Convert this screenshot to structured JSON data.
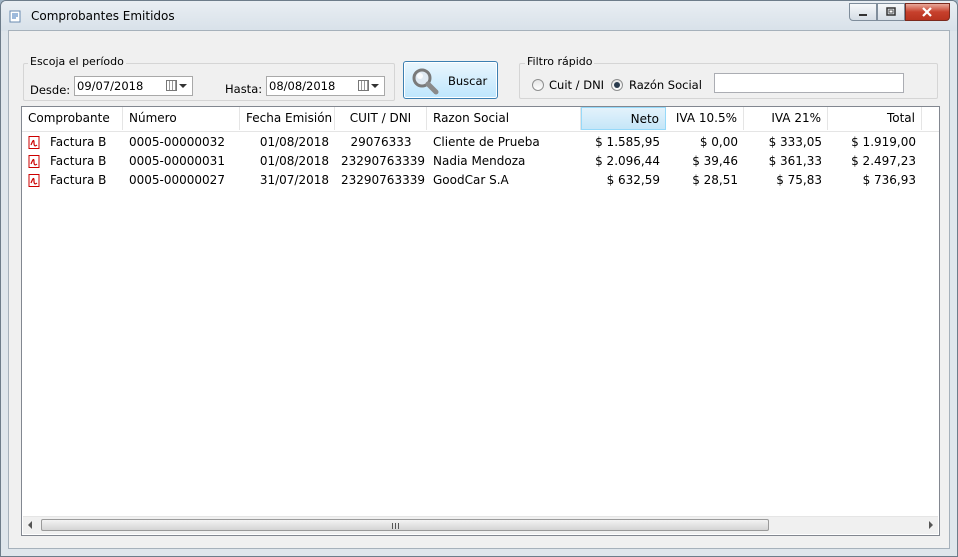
{
  "window": {
    "title": "Comprobantes Emitidos",
    "accent": "#3c7fb1"
  },
  "periodo": {
    "group_label": "Escoja el período",
    "desde_label": "Desde:",
    "desde_value": "09/07/2018",
    "hasta_label": "Hasta:",
    "hasta_value": "08/08/2018"
  },
  "buscar": {
    "label": "Buscar",
    "icon": "magnifier-icon"
  },
  "filtro": {
    "group_label": "Filtro rápido",
    "opt_cuit": "Cuit / DNI",
    "opt_razon": "Razón Social",
    "selected": "Razón Social",
    "search_value": ""
  },
  "table": {
    "columns": [
      "Comprobante",
      "Número",
      "Fecha Emisión",
      "CUIT / DNI",
      "Razon Social",
      "Neto",
      "IVA 10.5%",
      "IVA 21%",
      "Total"
    ],
    "sorted_column": "Neto",
    "rows": [
      {
        "tipo": "Factura B",
        "numero": "0005-00000032",
        "fecha": "01/08/2018",
        "cuit": "29076333",
        "razon": "Cliente de Prueba",
        "neto": "$ 1.585,95",
        "iva105": "$ 0,00",
        "iva21": "$ 333,05",
        "total": "$ 1.919,00"
      },
      {
        "tipo": "Factura B",
        "numero": "0005-00000031",
        "fecha": "01/08/2018",
        "cuit": "23290763339",
        "razon": "Nadia Mendoza",
        "neto": "$ 2.096,44",
        "iva105": "$ 39,46",
        "iva21": "$ 361,33",
        "total": "$ 2.497,23"
      },
      {
        "tipo": "Factura B",
        "numero": "0005-00000027",
        "fecha": "31/07/2018",
        "cuit": "23290763339",
        "razon": "GoodCar S.A",
        "neto": "$ 632,59",
        "iva105": "$ 28,51",
        "iva21": "$ 75,83",
        "total": "$ 736,93"
      }
    ]
  }
}
